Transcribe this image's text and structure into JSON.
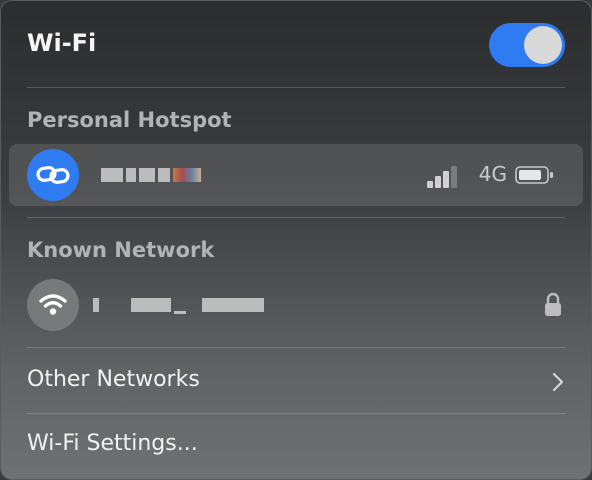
{
  "header": {
    "title": "Wi-Fi",
    "wifi_enabled": true,
    "toggle_color": "#2f7bf2"
  },
  "personal_hotspot": {
    "header": "Personal Hotspot",
    "device": {
      "icon": "link-chain-icon",
      "name_obscured": true,
      "network_type": "4G",
      "signal_bars": 3,
      "signal_bars_total": 4,
      "battery_icon": "battery-icon"
    }
  },
  "known_network": {
    "header": "Known Network",
    "network": {
      "icon": "wifi-icon",
      "name_obscured": true,
      "secured": true,
      "lock_icon": "lock-icon"
    }
  },
  "menu": {
    "other_networks": "Other Networks",
    "wifi_settings": "Wi-Fi Settings..."
  },
  "colors": {
    "accent": "#2f7bf2",
    "section_header": "#b2b3b5"
  }
}
